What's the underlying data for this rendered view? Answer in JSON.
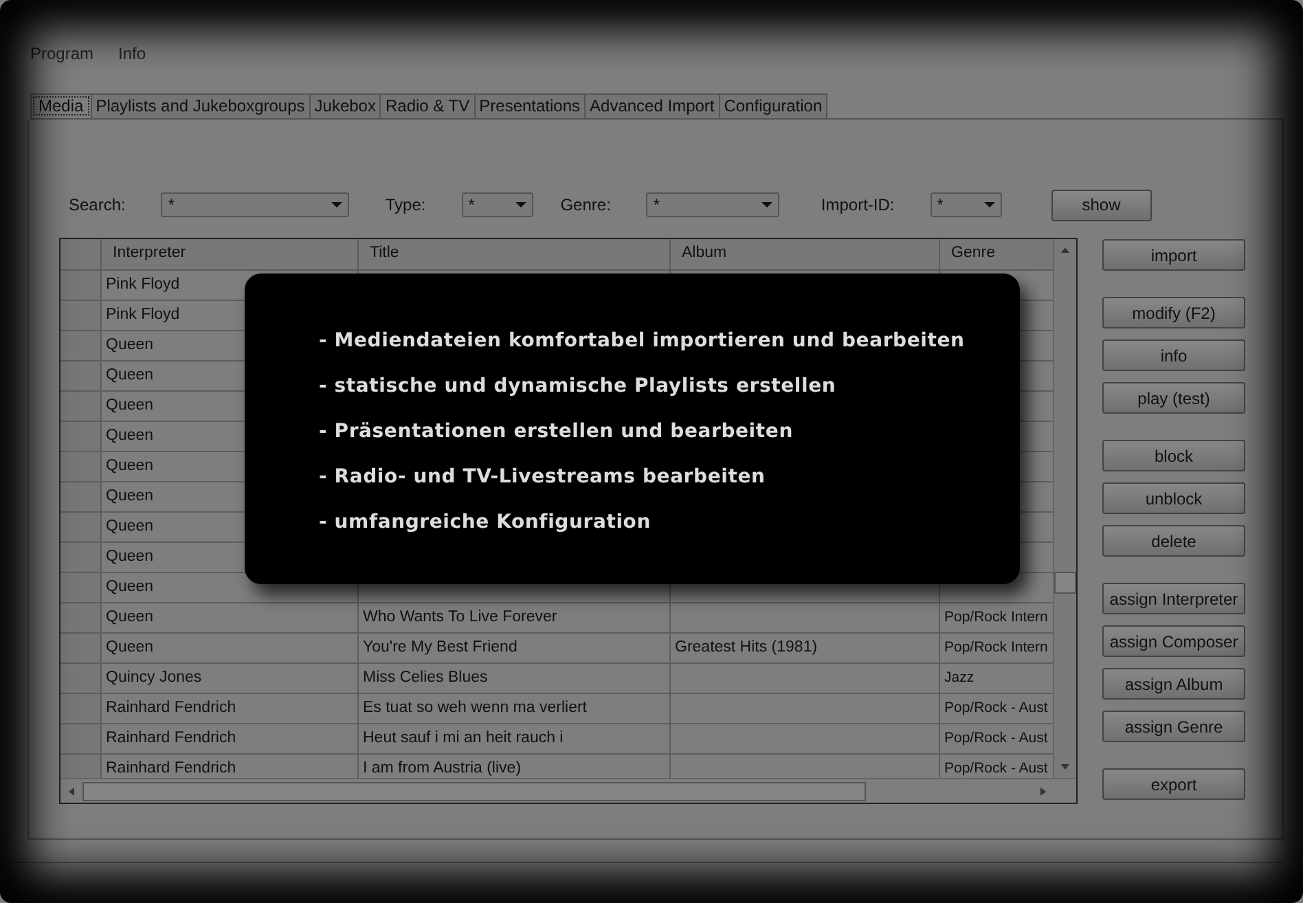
{
  "menu": [
    "Program",
    "Info"
  ],
  "tabs": [
    {
      "label": "Media",
      "selected": true
    },
    {
      "label": "Playlists and Jukeboxgroups",
      "selected": false
    },
    {
      "label": "Jukebox",
      "selected": false
    },
    {
      "label": "Radio & TV",
      "selected": false
    },
    {
      "label": "Presentations",
      "selected": false
    },
    {
      "label": "Advanced Import",
      "selected": false
    },
    {
      "label": "Configuration",
      "selected": false
    }
  ],
  "filters": [
    {
      "label": "Search:",
      "value": "*"
    },
    {
      "label": "Type:",
      "value": "*"
    },
    {
      "label": "Genre:",
      "value": "*"
    },
    {
      "label": "Import-ID:",
      "value": "*"
    }
  ],
  "show_button": "show",
  "table": {
    "columns": [
      "Interpreter",
      "Title",
      "Album",
      "Genre"
    ],
    "rows": [
      [
        "Pink Floyd",
        null,
        null,
        null
      ],
      [
        "Pink Floyd",
        null,
        null,
        null
      ],
      [
        "Queen",
        null,
        null,
        null
      ],
      [
        "Queen",
        null,
        null,
        null
      ],
      [
        "Queen",
        null,
        null,
        null
      ],
      [
        "Queen",
        null,
        null,
        null
      ],
      [
        "Queen",
        null,
        null,
        null
      ],
      [
        "Queen",
        null,
        null,
        null
      ],
      [
        "Queen",
        null,
        null,
        null
      ],
      [
        "Queen",
        null,
        null,
        null
      ],
      [
        "Queen",
        null,
        null,
        null
      ],
      [
        "Queen",
        "Who Wants To Live Forever",
        null,
        "Pop/Rock Intern"
      ],
      [
        "Queen",
        "You're My Best Friend",
        "Greatest Hits (1981)",
        "Pop/Rock Intern"
      ],
      [
        "Quincy Jones",
        "Miss Celies Blues",
        null,
        "Jazz"
      ],
      [
        "Rainhard Fendrich",
        "Es tuat so weh wenn ma verliert",
        null,
        "Pop/Rock - Aust"
      ],
      [
        "Rainhard Fendrich",
        "Heut sauf i mi an heit rauch i",
        null,
        "Pop/Rock - Aust"
      ],
      [
        "Rainhard Fendrich",
        "I am from Austria (live)",
        null,
        "Pop/Rock - Aust"
      ]
    ]
  },
  "button_groups": [
    [
      "import"
    ],
    [
      "modify (F2)",
      "info",
      "play (test)"
    ],
    [
      "block",
      "unblock",
      "delete"
    ],
    [
      "assign Interpreter",
      "assign Composer",
      "assign Album",
      "assign Genre"
    ],
    [
      "export"
    ]
  ],
  "overlay": {
    "lines": [
      "- Mediendateien komfortabel importieren und bearbeiten",
      "- statische und dynamische Playlists erstellen",
      "- Präsentationen erstellen und bearbeiten",
      "- Radio- und TV-Livestreams bearbeiten",
      "- umfangreiche Konfiguration"
    ]
  }
}
